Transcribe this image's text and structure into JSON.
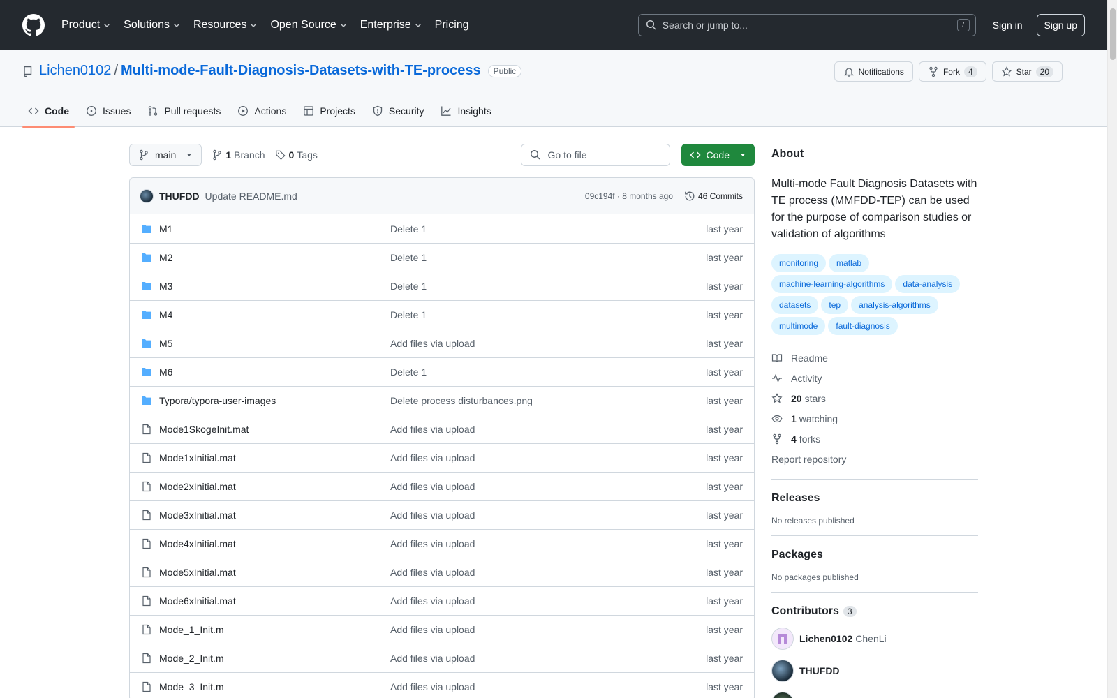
{
  "header": {
    "nav": [
      "Product",
      "Solutions",
      "Resources",
      "Open Source",
      "Enterprise",
      "Pricing"
    ],
    "search_placeholder": "Search or jump to...",
    "search_shortcut": "/",
    "signin": "Sign in",
    "signup": "Sign up"
  },
  "repo": {
    "owner": "Lichen0102",
    "separator": "/",
    "name": "Multi-mode-Fault-Diagnosis-Datasets-with-TE-process",
    "visibility": "Public",
    "notifications_label": "Notifications",
    "fork_label": "Fork",
    "fork_count": "4",
    "star_label": "Star",
    "star_count": "20"
  },
  "tabs": [
    {
      "label": "Code",
      "icon": "code-icon"
    },
    {
      "label": "Issues",
      "icon": "issue-icon"
    },
    {
      "label": "Pull requests",
      "icon": "pull-request-icon"
    },
    {
      "label": "Actions",
      "icon": "play-icon"
    },
    {
      "label": "Projects",
      "icon": "table-icon"
    },
    {
      "label": "Security",
      "icon": "shield-icon"
    },
    {
      "label": "Insights",
      "icon": "graph-icon"
    }
  ],
  "toolbar": {
    "branch": "main",
    "branch_count": "1",
    "branch_label": "Branch",
    "tag_count": "0",
    "tag_label": "Tags",
    "goto_placeholder": "Go to file",
    "code_button": "Code"
  },
  "commit": {
    "author": "THUFDD",
    "message": "Update README.md",
    "hash_time": "09c194f · 8 months ago",
    "commits_count": "46 Commits"
  },
  "files": [
    {
      "name": "M1",
      "type": "folder",
      "message": "Delete 1",
      "date": "last year"
    },
    {
      "name": "M2",
      "type": "folder",
      "message": "Delete 1",
      "date": "last year"
    },
    {
      "name": "M3",
      "type": "folder",
      "message": "Delete 1",
      "date": "last year"
    },
    {
      "name": "M4",
      "type": "folder",
      "message": "Delete 1",
      "date": "last year"
    },
    {
      "name": "M5",
      "type": "folder",
      "message": "Add files via upload",
      "date": "last year"
    },
    {
      "name": "M6",
      "type": "folder",
      "message": "Delete 1",
      "date": "last year"
    },
    {
      "name": "Typora/typora-user-images",
      "type": "folder",
      "message": "Delete process disturbances.png",
      "date": "last year"
    },
    {
      "name": "Mode1SkogeInit.mat",
      "type": "file",
      "message": "Add files via upload",
      "date": "last year"
    },
    {
      "name": "Mode1xInitial.mat",
      "type": "file",
      "message": "Add files via upload",
      "date": "last year"
    },
    {
      "name": "Mode2xInitial.mat",
      "type": "file",
      "message": "Add files via upload",
      "date": "last year"
    },
    {
      "name": "Mode3xInitial.mat",
      "type": "file",
      "message": "Add files via upload",
      "date": "last year"
    },
    {
      "name": "Mode4xInitial.mat",
      "type": "file",
      "message": "Add files via upload",
      "date": "last year"
    },
    {
      "name": "Mode5xInitial.mat",
      "type": "file",
      "message": "Add files via upload",
      "date": "last year"
    },
    {
      "name": "Mode6xInitial.mat",
      "type": "file",
      "message": "Add files via upload",
      "date": "last year"
    },
    {
      "name": "Mode_1_Init.m",
      "type": "file",
      "message": "Add files via upload",
      "date": "last year"
    },
    {
      "name": "Mode_2_Init.m",
      "type": "file",
      "message": "Add files via upload",
      "date": "last year"
    },
    {
      "name": "Mode_3_Init.m",
      "type": "file",
      "message": "Add files via upload",
      "date": "last year"
    }
  ],
  "about": {
    "title": "About",
    "description": "Multi-mode Fault Diagnosis Datasets with TE process (MMFDD-TEP) can be used for the purpose of comparison studies or validation of algorithms",
    "topics": [
      "monitoring",
      "matlab",
      "machine-learning-algorithms",
      "data-analysis",
      "datasets",
      "tep",
      "analysis-algorithms",
      "multimode",
      "fault-diagnosis"
    ],
    "readme": "Readme",
    "activity": "Activity",
    "stars_count": "20",
    "stars_label": "stars",
    "watching_count": "1",
    "watching_label": "watching",
    "forks_count": "4",
    "forks_label": "forks",
    "report": "Report repository"
  },
  "releases": {
    "title": "Releases",
    "note": "No releases published"
  },
  "packages": {
    "title": "Packages",
    "note": "No packages published"
  },
  "contributors": {
    "title": "Contributors",
    "count": "3",
    "list": [
      {
        "login": "Lichen0102",
        "name": "ChenLi"
      },
      {
        "login": "THUFDD",
        "name": ""
      }
    ]
  },
  "colors": {
    "accent": "#0969da",
    "header_bg": "#24292f",
    "code_button": "#1f883d",
    "tab_underline": "#fd8c73",
    "folder": "#54aeff"
  }
}
